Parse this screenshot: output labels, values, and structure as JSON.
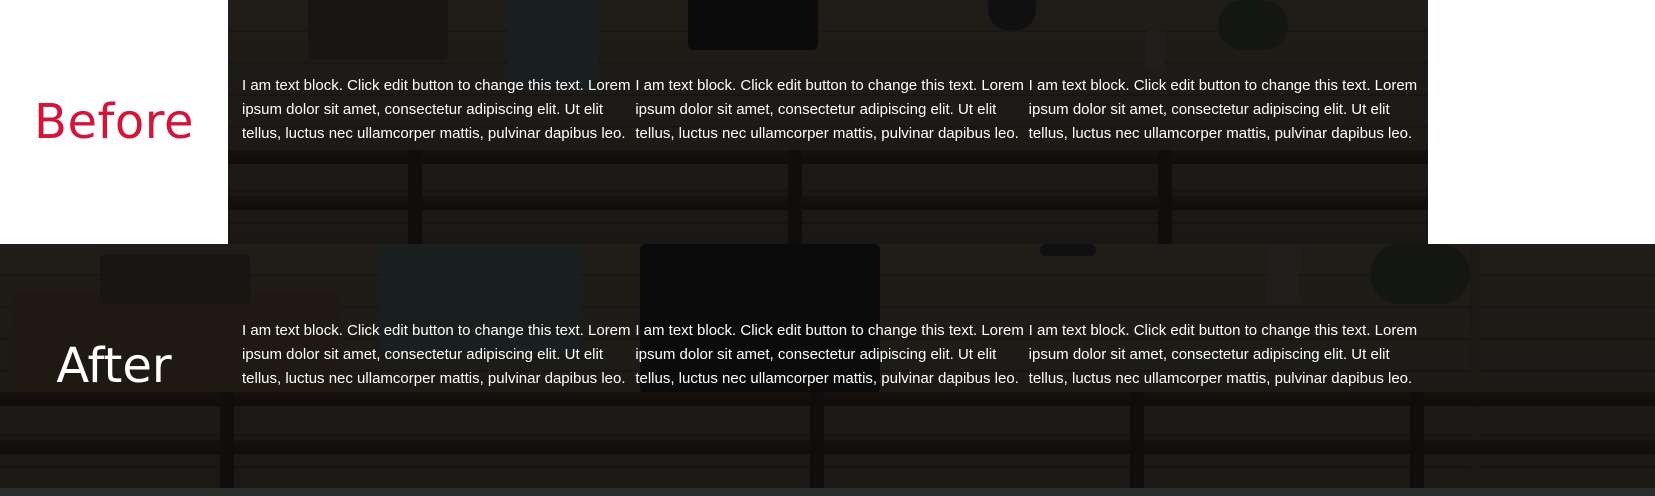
{
  "before": {
    "label": "Before",
    "columns": [
      {
        "text": "I am text block. Click edit button to change this text. Lorem ipsum dolor sit amet, consectetur adipiscing elit. Ut elit tellus, luctus nec ullamcorper mattis, pulvinar dapibus leo."
      },
      {
        "text": "I am text block. Click edit button to change this text. Lorem ipsum dolor sit amet, consectetur adipiscing elit. Ut elit tellus, luctus nec ullamcorper mattis, pulvinar dapibus leo."
      },
      {
        "text": "I am text block. Click edit button to change this text. Lorem ipsum dolor sit amet, consectetur adipiscing elit. Ut elit tellus, luctus nec ullamcorper mattis, pulvinar dapibus leo."
      }
    ]
  },
  "after": {
    "label": "After",
    "columns": [
      {
        "text": "I am text block. Click edit button to change this text. Lorem ipsum dolor sit amet, consectetur adipiscing elit. Ut elit tellus, luctus nec ullamcorper mattis, pulvinar dapibus leo."
      },
      {
        "text": "I am text block. Click edit button to change this text. Lorem ipsum dolor sit amet, consectetur adipiscing elit. Ut elit tellus, luctus nec ullamcorper mattis, pulvinar dapibus leo."
      },
      {
        "text": "I am text block. Click edit button to change this text. Lorem ipsum dolor sit amet, consectetur adipiscing elit. Ut elit tellus, luctus nec ullamcorper mattis, pulvinar dapibus leo."
      }
    ]
  },
  "colors": {
    "before_label": "#d0163a",
    "after_label": "#ffffff",
    "overlay": "#0a0a0a"
  }
}
